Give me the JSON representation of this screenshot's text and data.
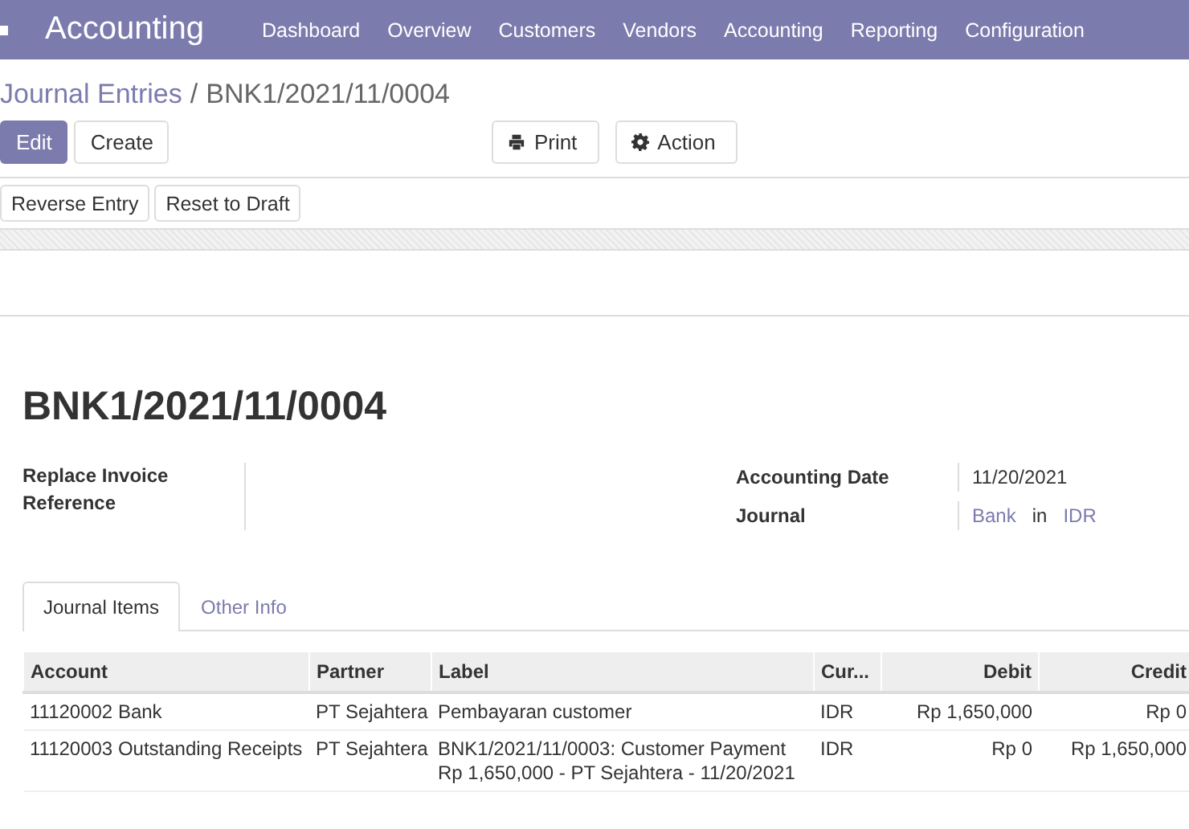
{
  "app": {
    "title": "Accounting"
  },
  "menu": [
    "Dashboard",
    "Overview",
    "Customers",
    "Vendors",
    "Accounting",
    "Reporting",
    "Configuration"
  ],
  "breadcrumb": {
    "parent": "Journal Entries",
    "separator": "/",
    "current": "BNK1/2021/11/0004"
  },
  "main_buttons": [
    {
      "label": "Edit",
      "primary": true
    },
    {
      "label": "Create",
      "primary": false
    }
  ],
  "action_buttons": [
    {
      "label": "Print",
      "kind": "print"
    },
    {
      "label": "Action",
      "kind": "gear"
    }
  ],
  "status_buttons": [
    "Reverse Entry",
    "Reset to Draft"
  ],
  "record": {
    "title": "BNK1/2021/11/0004",
    "left_fields": [
      {
        "label": "Replace Invoice Reference"
      }
    ],
    "right_fields": [
      {
        "kind": "text",
        "label": "Accounting Date",
        "value": "11/20/2021"
      },
      {
        "kind": "journal",
        "label": "Journal",
        "journal": "Bank",
        "joiner": "in",
        "currency": "IDR"
      }
    ]
  },
  "tabs": [
    {
      "label": "Journal Items",
      "selected": true
    },
    {
      "label": "Other Info",
      "selected": false
    }
  ],
  "table": {
    "columns": [
      "Account",
      "Partner",
      "Label",
      "Cur...",
      "Debit",
      "Credit"
    ],
    "rows": [
      [
        "11120002 Bank",
        "PT Sejahtera",
        "Pembayaran customer",
        "IDR",
        "Rp 1,650,000",
        "Rp 0"
      ],
      [
        "11120003 Outstanding Receipts",
        "PT Sejahtera",
        "BNK1/2021/11/0003: Customer Payment Rp 1,650,000 - PT Sejahtera - 11/20/2021",
        "IDR",
        "Rp 0",
        "Rp 1,650,000"
      ]
    ]
  }
}
